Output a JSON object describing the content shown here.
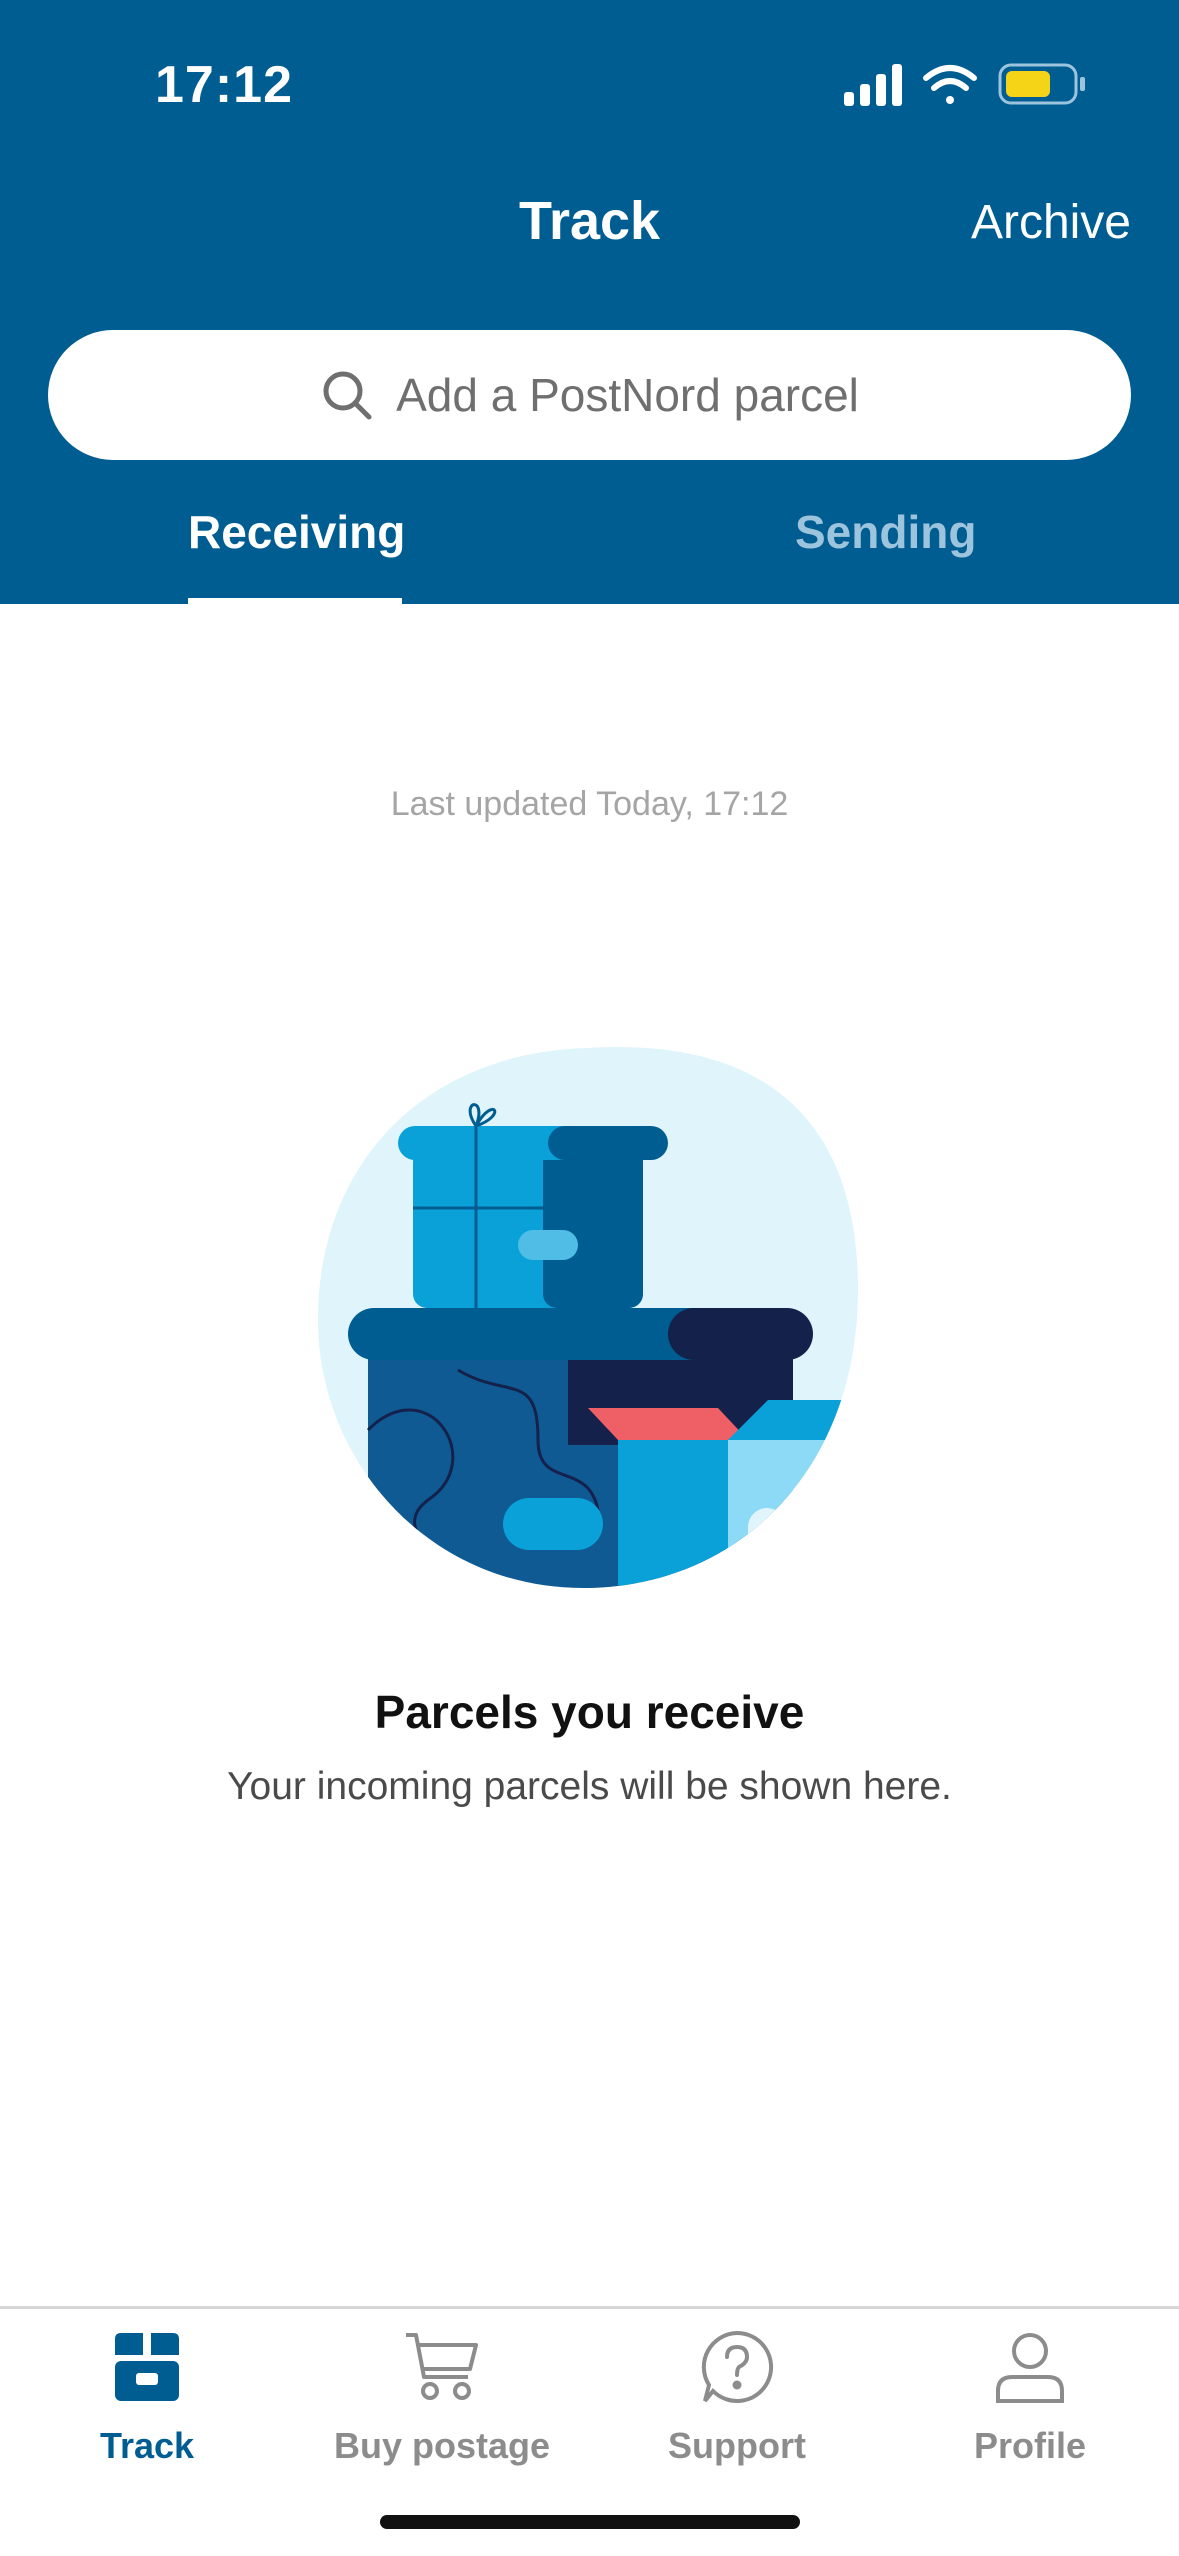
{
  "status_bar": {
    "time": "17:12",
    "battery_color": "#f5d417"
  },
  "nav": {
    "title": "Track",
    "archive_label": "Archive"
  },
  "search": {
    "placeholder": "Add a PostNord parcel"
  },
  "tabs": [
    {
      "label": "Receiving",
      "selected": true
    },
    {
      "label": "Sending",
      "selected": false
    }
  ],
  "content": {
    "last_updated": "Last updated Today, 17:12",
    "empty_title": "Parcels you receive",
    "empty_subtitle": "Your incoming parcels will be shown here."
  },
  "tabbar": {
    "items": [
      {
        "label": "Track",
        "icon": "parcel-icon",
        "active": true
      },
      {
        "label": "Buy postage",
        "icon": "cart-icon",
        "active": false
      },
      {
        "label": "Support",
        "icon": "question-icon",
        "active": false
      },
      {
        "label": "Profile",
        "icon": "person-icon",
        "active": false
      }
    ]
  },
  "colors": {
    "brand_blue": "#005d92",
    "inactive_tab": "#9cc4dc",
    "tabbar_inactive": "#8c8c8c"
  }
}
